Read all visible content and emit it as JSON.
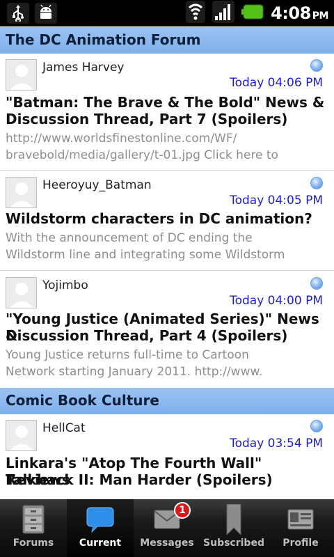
{
  "status_bar": {
    "left_icons": [
      "usb-icon",
      "android-debug-icon"
    ],
    "right_icons": [
      "wifi-icon",
      "signal-icon",
      "battery-icon"
    ],
    "time": "4:08",
    "ampm": "PM"
  },
  "sections": [
    {
      "title": "The DC Animation Forum",
      "threads": [
        {
          "author": "James Harvey",
          "time": "Today 04:06 PM",
          "title_lines": [
            "\"Batman: The Brave & The Bold\" News &",
            "Discussion Thread, Part 7 (Spoilers)"
          ],
          "preview_lines": [
            "http://www.worldsfinestonline.com/WF/",
            "bravebold/media/gallery/t-01.jpg Click here to"
          ]
        },
        {
          "author": "Heeroyuy_Batman",
          "time": "Today 04:05 PM",
          "title_lines": [
            "Wildstorm characters in DC animation?"
          ],
          "preview_lines": [
            "With the announcement of DC ending the",
            "Wildstorm line and integrating some Wildstorm"
          ]
        },
        {
          "author": "Yojimbo",
          "time": "Today 04:00 PM",
          "title_lines": [
            "\"Young Justice (Animated Series)\" News &",
            "Discussion Thread, Part 4 (Spoilers)"
          ],
          "preview_lines": [
            "Young Justice returns full-time to Cartoon",
            "Network starting January 2011.  http://www."
          ]
        }
      ]
    },
    {
      "title": "Comic Book Culture",
      "threads": [
        {
          "author": "HellCat",
          "time": "Today 03:54 PM",
          "title_lines": [
            "Linkara's \"Atop The Fourth Wall\" Reviews",
            "Talkback II: Man Harder (Spoilers)"
          ],
          "preview_lines": []
        }
      ]
    }
  ],
  "bottom_nav": {
    "tabs": [
      {
        "label": "Forums",
        "icon": "filing-cabinet-icon",
        "active": false
      },
      {
        "label": "Current",
        "icon": "speech-bubble-icon",
        "active": true
      },
      {
        "label": "Messages",
        "icon": "envelope-icon",
        "active": false,
        "badge": "1"
      },
      {
        "label": "Subscribed",
        "icon": "bookmark-icon",
        "active": false
      },
      {
        "label": "Profile",
        "icon": "id-card-icon",
        "active": false
      }
    ]
  },
  "colors": {
    "section_header": "#8ab8ef",
    "timestamp": "#1b1bd6",
    "preview_text": "#8e8e8e",
    "badge": "#d51a1a"
  }
}
